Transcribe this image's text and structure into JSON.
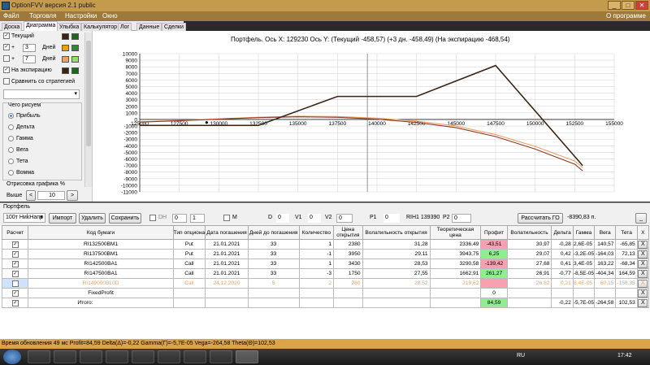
{
  "window": {
    "title": "OptionFVV версия 2.1 public",
    "about": "О программе"
  },
  "menu": [
    "Файл",
    "Торговля",
    "Настройки",
    "Окно"
  ],
  "tabs": [
    "Доска",
    "Диаграмма",
    "Улыбка",
    "Калькулятор",
    "Лог",
    "Данные",
    "Сделки"
  ],
  "left": {
    "current": "Текущий",
    "plus1_value": "3",
    "plus2_value": "7",
    "days": "Дней",
    "expiration": "На экспирацию",
    "compare": "Сравнить со стратегией",
    "what_title": "Чего рисуем",
    "options": [
      "Прибыль",
      "Дельта",
      "Гамма",
      "Вега",
      "Тета",
      "Вомма"
    ],
    "render_title": "Отрисовка графика %",
    "above": "Выше",
    "above_value": "10",
    "plus": "+",
    "lt": "<",
    "gt": ">"
  },
  "colors": {
    "current": "#3c2414",
    "plus3": "#f0a000",
    "plus3b": "#2d8a2d",
    "plus7": "#f0a060",
    "plus7b": "#90e060",
    "expiry": "#3c2414",
    "expiryb": "#1a6a1a"
  },
  "chart": {
    "header": "Портфель. Ось X: 129230 Ось Y:  (Текущий -458,57)  (+3 дн. -458,49)  (На экспирацию -468,54)"
  },
  "chart_data": {
    "type": "line",
    "xlim": [
      125000,
      155000
    ],
    "ylim": [
      -11000,
      10000
    ],
    "x_ticks": [
      "125000",
      "127500",
      "130000",
      "132500",
      "135000",
      "137500",
      "140000",
      "142500",
      "145000",
      "147500",
      "150000",
      "152500",
      "155000"
    ],
    "y_ticks": [
      "10000",
      "9000",
      "8000",
      "7000",
      "6000",
      "5000",
      "4000",
      "3000",
      "2000",
      "1000",
      "0",
      "-1000",
      "-2000",
      "-3000",
      "-4000",
      "-5000",
      "-6000",
      "-7000",
      "-8000",
      "-9000",
      "-10000",
      "-11000"
    ],
    "cursor_x": 129230,
    "marker_y": -458.57,
    "series": [
      {
        "x": [
          125000,
          127500,
          130000,
          132500,
          135000,
          137500,
          140000,
          142500,
          145000,
          147500,
          150000,
          152500,
          153000
        ],
        "y": [
          -350,
          -150,
          100,
          350,
          500,
          450,
          200,
          -250,
          -1000,
          -2300,
          -4100,
          -6300,
          -7300
        ]
      },
      {
        "x": [
          125000,
          127500,
          130000,
          132500,
          135000,
          137500,
          140000,
          142500,
          145000,
          147500,
          150000,
          152500,
          153000
        ],
        "y": [
          -400,
          -200,
          50,
          280,
          400,
          330,
          50,
          -450,
          -1250,
          -2600,
          -4500,
          -6800,
          -7800
        ]
      },
      {
        "x": [
          125000,
          132500,
          137500,
          142500,
          147500,
          153000
        ],
        "y": [
          -900,
          -900,
          3500,
          3500,
          8200,
          -7000
        ]
      }
    ]
  },
  "portfolio": {
    "label": "Портфель",
    "select": "100т НиkНапр",
    "import": "Импорт",
    "delete": "Удалить",
    "save": "Сохранить",
    "dh": "DH",
    "dh_v1": "0",
    "dh_v2": "1",
    "m": "M",
    "d_label": "D",
    "d_val": "0",
    "v1_label": "V1",
    "v1_val": "0",
    "v2_label": "V2",
    "v2_val": "0",
    "p1_label": "P1",
    "p1_val": "0",
    "rih": "RIH1 139390",
    "p2_label": "P2",
    "p2_val": "0",
    "calc_go": "Рассчитать ГО",
    "go_value": "-8390,83 п.",
    "minimize": "_"
  },
  "table": {
    "headers": [
      "Расчет",
      "Код бумаги",
      "Тип опциона",
      "Дата погашения",
      "Дней до погашения",
      "Количество",
      "Цена открытия",
      "Волатильность открытия",
      "Теоретическая цена",
      "Профит",
      "Волатильность",
      "Дельта",
      "Гамма",
      "Вега",
      "Тета",
      "X"
    ],
    "rows": [
      {
        "checked": true,
        "cells": [
          "RI132500BM1",
          "Put",
          "21.01.2021",
          "33",
          "1",
          "2380",
          "31,28",
          "2336,49",
          "-43,51",
          "30,97",
          "-0,28",
          "2,6E-05",
          "140,57",
          "-65,85"
        ],
        "profit_color": "#f8a0b0"
      },
      {
        "checked": true,
        "cells": [
          "RI137500BM1",
          "Put",
          "21.01.2021",
          "33",
          "-1",
          "3950",
          "29,11",
          "3943,75",
          "6,25",
          "29,07",
          "0,42",
          "-3,2E-05",
          "-164,03",
          "72,13"
        ],
        "profit_color": "#90ee90"
      },
      {
        "checked": true,
        "cells": [
          "RI142500BA1",
          "Call",
          "21.01.2021",
          "33",
          "1",
          "3430",
          "28,53",
          "3290,58",
          "-139,42",
          "27,68",
          "0,41",
          "3,4E-05",
          "163,22",
          "-68,34"
        ],
        "profit_color": "#f8a0b0"
      },
      {
        "checked": true,
        "cells": [
          "RI147500BA1",
          "Call",
          "21.01.2021",
          "33",
          "-3",
          "1750",
          "27,55",
          "1662,91",
          "261,27",
          "26,91",
          "-0,77",
          "-8,5E-05",
          "-404,34",
          "164,59"
        ],
        "profit_color": "#90ee90"
      },
      {
        "checked": false,
        "dim": true,
        "cells": [
          "RI149000BL0D",
          "Call",
          "24.12.2020",
          "5",
          "2",
          "280",
          "28,52",
          "219,62",
          "",
          "26,62",
          "0,21",
          "8,4E-05",
          "60,15",
          "-158,35"
        ],
        "profit_color": "#f8a0b0"
      },
      {
        "checked": true,
        "cells": [
          "FixedProfit",
          "",
          "",
          "",
          "",
          "",
          "",
          "",
          "0",
          "",
          "",
          "",
          "",
          ""
        ],
        "profit_color": "#ffffff"
      },
      {
        "checked": true,
        "cells": [
          "Итого:",
          "",
          "",
          "",
          "",
          "",
          "",
          "",
          "84,59",
          "",
          "-0,22",
          "-5,7E-05",
          "-264,58",
          "102,53"
        ],
        "profit_color": "#90ee90"
      }
    ],
    "x": "X"
  },
  "status": "Время обновления 49 мс  Profit=84,59 Delta(Δ)=-0,22 Gamma(Γ)=-5,7E-05 Vega=-264,58 Theta(Θ)=102,53",
  "taskbar": {
    "lang": "RU",
    "time": "17:42"
  }
}
